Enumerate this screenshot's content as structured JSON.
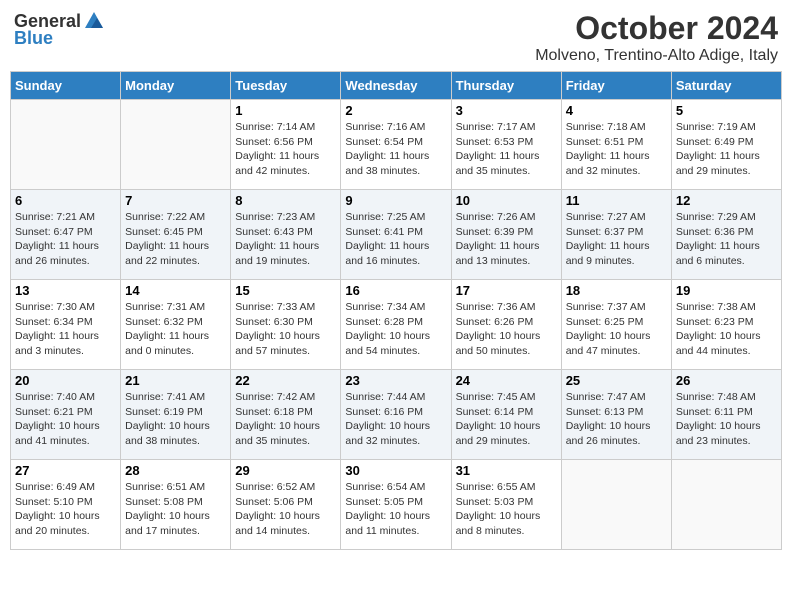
{
  "logo": {
    "general": "General",
    "blue": "Blue"
  },
  "title": "October 2024",
  "location": "Molveno, Trentino-Alto Adige, Italy",
  "days_of_week": [
    "Sunday",
    "Monday",
    "Tuesday",
    "Wednesday",
    "Thursday",
    "Friday",
    "Saturday"
  ],
  "weeks": [
    {
      "days": [
        {
          "number": "",
          "empty": true
        },
        {
          "number": "",
          "empty": true
        },
        {
          "number": "1",
          "sunrise": "7:14 AM",
          "sunset": "6:56 PM",
          "daylight": "11 hours and 42 minutes."
        },
        {
          "number": "2",
          "sunrise": "7:16 AM",
          "sunset": "6:54 PM",
          "daylight": "11 hours and 38 minutes."
        },
        {
          "number": "3",
          "sunrise": "7:17 AM",
          "sunset": "6:53 PM",
          "daylight": "11 hours and 35 minutes."
        },
        {
          "number": "4",
          "sunrise": "7:18 AM",
          "sunset": "6:51 PM",
          "daylight": "11 hours and 32 minutes."
        },
        {
          "number": "5",
          "sunrise": "7:19 AM",
          "sunset": "6:49 PM",
          "daylight": "11 hours and 29 minutes."
        }
      ]
    },
    {
      "days": [
        {
          "number": "6",
          "sunrise": "7:21 AM",
          "sunset": "6:47 PM",
          "daylight": "11 hours and 26 minutes."
        },
        {
          "number": "7",
          "sunrise": "7:22 AM",
          "sunset": "6:45 PM",
          "daylight": "11 hours and 22 minutes."
        },
        {
          "number": "8",
          "sunrise": "7:23 AM",
          "sunset": "6:43 PM",
          "daylight": "11 hours and 19 minutes."
        },
        {
          "number": "9",
          "sunrise": "7:25 AM",
          "sunset": "6:41 PM",
          "daylight": "11 hours and 16 minutes."
        },
        {
          "number": "10",
          "sunrise": "7:26 AM",
          "sunset": "6:39 PM",
          "daylight": "11 hours and 13 minutes."
        },
        {
          "number": "11",
          "sunrise": "7:27 AM",
          "sunset": "6:37 PM",
          "daylight": "11 hours and 9 minutes."
        },
        {
          "number": "12",
          "sunrise": "7:29 AM",
          "sunset": "6:36 PM",
          "daylight": "11 hours and 6 minutes."
        }
      ]
    },
    {
      "days": [
        {
          "number": "13",
          "sunrise": "7:30 AM",
          "sunset": "6:34 PM",
          "daylight": "11 hours and 3 minutes."
        },
        {
          "number": "14",
          "sunrise": "7:31 AM",
          "sunset": "6:32 PM",
          "daylight": "11 hours and 0 minutes."
        },
        {
          "number": "15",
          "sunrise": "7:33 AM",
          "sunset": "6:30 PM",
          "daylight": "10 hours and 57 minutes."
        },
        {
          "number": "16",
          "sunrise": "7:34 AM",
          "sunset": "6:28 PM",
          "daylight": "10 hours and 54 minutes."
        },
        {
          "number": "17",
          "sunrise": "7:36 AM",
          "sunset": "6:26 PM",
          "daylight": "10 hours and 50 minutes."
        },
        {
          "number": "18",
          "sunrise": "7:37 AM",
          "sunset": "6:25 PM",
          "daylight": "10 hours and 47 minutes."
        },
        {
          "number": "19",
          "sunrise": "7:38 AM",
          "sunset": "6:23 PM",
          "daylight": "10 hours and 44 minutes."
        }
      ]
    },
    {
      "days": [
        {
          "number": "20",
          "sunrise": "7:40 AM",
          "sunset": "6:21 PM",
          "daylight": "10 hours and 41 minutes."
        },
        {
          "number": "21",
          "sunrise": "7:41 AM",
          "sunset": "6:19 PM",
          "daylight": "10 hours and 38 minutes."
        },
        {
          "number": "22",
          "sunrise": "7:42 AM",
          "sunset": "6:18 PM",
          "daylight": "10 hours and 35 minutes."
        },
        {
          "number": "23",
          "sunrise": "7:44 AM",
          "sunset": "6:16 PM",
          "daylight": "10 hours and 32 minutes."
        },
        {
          "number": "24",
          "sunrise": "7:45 AM",
          "sunset": "6:14 PM",
          "daylight": "10 hours and 29 minutes."
        },
        {
          "number": "25",
          "sunrise": "7:47 AM",
          "sunset": "6:13 PM",
          "daylight": "10 hours and 26 minutes."
        },
        {
          "number": "26",
          "sunrise": "7:48 AM",
          "sunset": "6:11 PM",
          "daylight": "10 hours and 23 minutes."
        }
      ]
    },
    {
      "days": [
        {
          "number": "27",
          "sunrise": "6:49 AM",
          "sunset": "5:10 PM",
          "daylight": "10 hours and 20 minutes."
        },
        {
          "number": "28",
          "sunrise": "6:51 AM",
          "sunset": "5:08 PM",
          "daylight": "10 hours and 17 minutes."
        },
        {
          "number": "29",
          "sunrise": "6:52 AM",
          "sunset": "5:06 PM",
          "daylight": "10 hours and 14 minutes."
        },
        {
          "number": "30",
          "sunrise": "6:54 AM",
          "sunset": "5:05 PM",
          "daylight": "10 hours and 11 minutes."
        },
        {
          "number": "31",
          "sunrise": "6:55 AM",
          "sunset": "5:03 PM",
          "daylight": "10 hours and 8 minutes."
        },
        {
          "number": "",
          "empty": true
        },
        {
          "number": "",
          "empty": true
        }
      ]
    }
  ]
}
